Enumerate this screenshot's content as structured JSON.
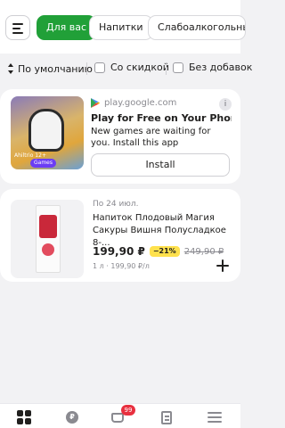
{
  "chips": {
    "items": [
      {
        "label": "Для вас",
        "active": true
      },
      {
        "label": "Напитки",
        "active": false
      },
      {
        "label": "Слабоалкогольные н",
        "active": false
      }
    ]
  },
  "filters": {
    "sort_label": "По умолчанию",
    "discount_label": "Со скидкой",
    "other_label": "Без добавок"
  },
  "ad": {
    "source": "play.google.com",
    "title": "Play for Free on Your Phone",
    "description": "New games are waiting for you. Install this app",
    "install_label": "Install",
    "image_meta": "Ahiltrio 12+",
    "image_badge": "Games",
    "info_icon": "i"
  },
  "product": {
    "date": "По 24 июл.",
    "title": "Напиток Плодовый Магия Сакуры Вишня Полусладкое 8-...",
    "price": "199,90 ₽",
    "discount": "−21%",
    "old_price": "249,90 ₽",
    "unit_price": "1 л · 199,90 ₽/л"
  },
  "nav": {
    "coin_symbol": "₽",
    "cart_count": "99"
  },
  "colors": {
    "accent": "#21a038",
    "discount_badge": "#ffe14d",
    "cart_badge": "#e8303f"
  },
  "icons": [
    "hamburger-icon",
    "sort-icon",
    "play-store-icon",
    "info-icon",
    "plus-icon",
    "grid-icon",
    "coin-icon",
    "cart-icon",
    "list-icon",
    "menu-icon"
  ]
}
